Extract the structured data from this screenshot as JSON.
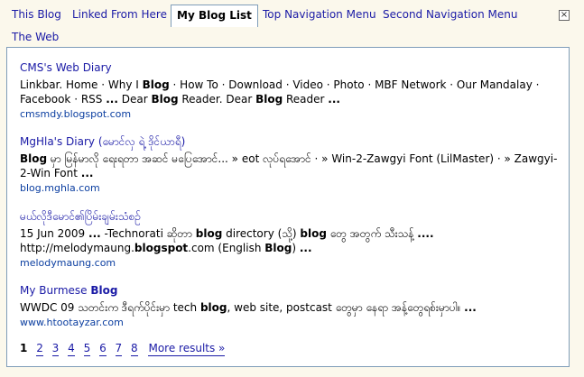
{
  "tabs": [
    {
      "label": "This Blog"
    },
    {
      "label": "Linked From Here"
    },
    {
      "label": "My Blog List"
    },
    {
      "label": "Top Navigation Menu"
    },
    {
      "label": "Second Navigation Menu"
    },
    {
      "label": "The Web"
    }
  ],
  "close_label": "×",
  "results": [
    {
      "title": "CMS's Web Diary",
      "snippet": [
        {
          "t": "Linkbar. Home · Why I "
        },
        {
          "t": "Blog",
          "b": true
        },
        {
          "t": " · How To · Download · Video · Photo · MBF Network · Our Mandalay · Facebook · RSS "
        },
        {
          "t": "...",
          "b": true
        },
        {
          "t": " Dear "
        },
        {
          "t": "Blog",
          "b": true
        },
        {
          "t": " Reader. Dear "
        },
        {
          "t": "Blog",
          "b": true
        },
        {
          "t": " Reader "
        },
        {
          "t": "...",
          "b": true
        }
      ],
      "url": "cmsmdy.blogspot.com"
    },
    {
      "title": "MgHla's Diary (မောင်လှ ရဲ့ ဒိုင်ယာရီ)",
      "snippet": [
        {
          "t": "Blog",
          "b": true
        },
        {
          "t": " မှာ မြန်မာလို ရေးရတာ အဆင် မပြေအောင်... » eot လုပ်ရအောင် · » Win-2-Zawgyi Font (LilMaster) · » Zawgyi-2-Win Font "
        },
        {
          "t": "...",
          "b": true
        }
      ],
      "url": "blog.mghla.com"
    },
    {
      "title": "မယ်လိုဒီမောင်၏ပြိမ်းချမ်းသံစဉ်",
      "snippet": [
        {
          "t": "15 Jun 2009 "
        },
        {
          "t": "...",
          "b": true
        },
        {
          "t": " -Technorati ဆိုတာ "
        },
        {
          "t": "blog",
          "b": true
        },
        {
          "t": " directory (သို့) "
        },
        {
          "t": "blog",
          "b": true
        },
        {
          "t": " တွေ အတွက် သီးသန့် "
        },
        {
          "t": "....",
          "b": true
        },
        {
          "t": " http://melodymaung."
        },
        {
          "t": "blogspot",
          "b": true
        },
        {
          "t": ".com (English "
        },
        {
          "t": "Blog",
          "b": true
        },
        {
          "t": ") "
        },
        {
          "t": "...",
          "b": true
        }
      ],
      "url": "melodymaung.com"
    },
    {
      "title": [
        {
          "t": "My Burmese "
        },
        {
          "t": "Blog",
          "b": true
        }
      ],
      "snippet": [
        {
          "t": "WWDC 09 သတင်းက ဒီရက်ပိုင်းမှာ tech "
        },
        {
          "t": "blog",
          "b": true
        },
        {
          "t": ", web site, postcast တွေမှာ နေရာ အန့်တွေရစ်းမှာပါ။ "
        },
        {
          "t": "...",
          "b": true
        }
      ],
      "url": "www.htootayzar.com"
    }
  ],
  "pager": {
    "pages": [
      "1",
      "2",
      "3",
      "4",
      "5",
      "6",
      "7",
      "8"
    ],
    "current": "1",
    "more_label": "More results »"
  }
}
